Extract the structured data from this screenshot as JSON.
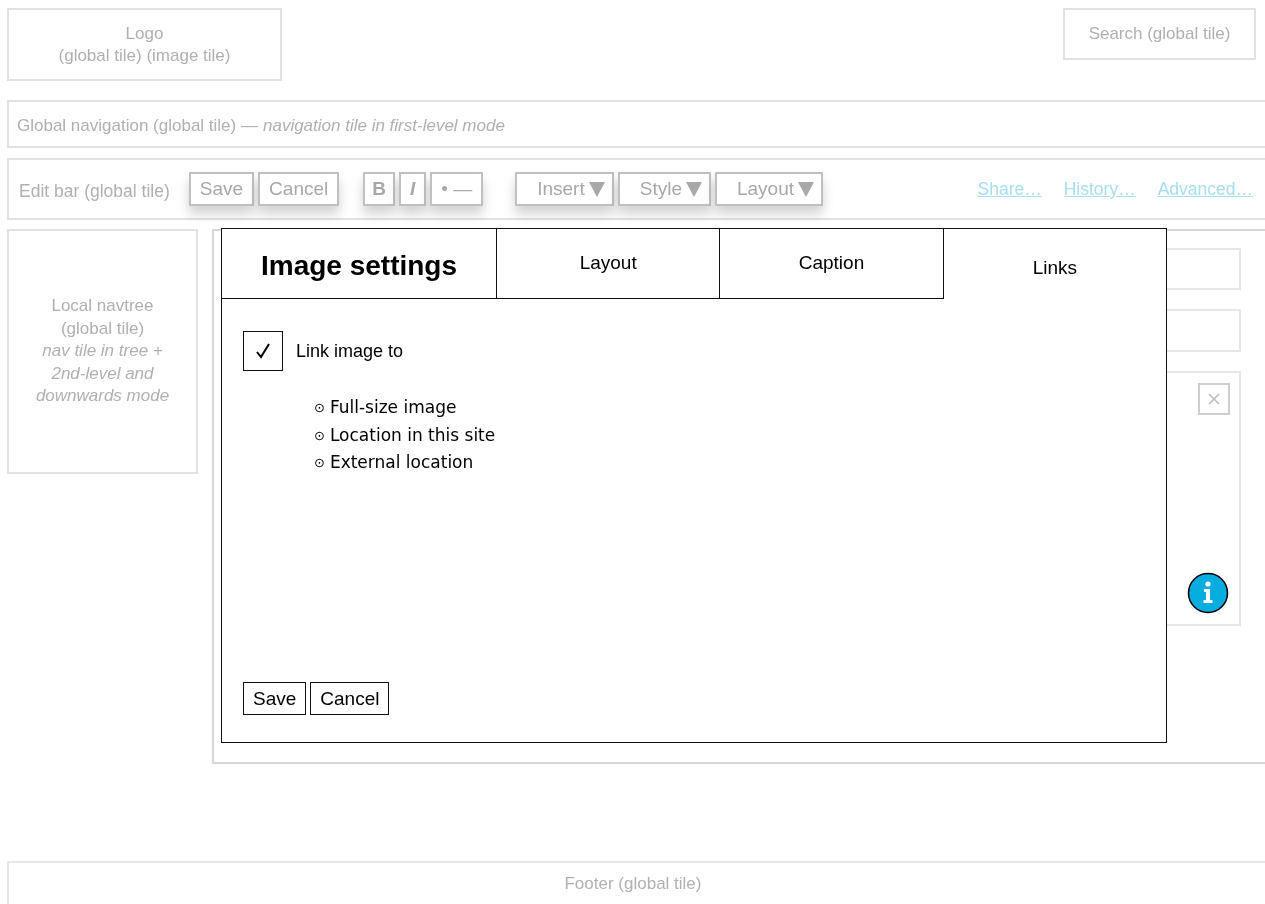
{
  "header": {
    "logo": [
      "Logo",
      "(global tile) (image tile)"
    ],
    "search": "Search (global tile)"
  },
  "global_nav": {
    "label": "Global navigation (global tile) —",
    "note": "navigation tile in first-level mode"
  },
  "edit_bar": {
    "label": "Edit bar (global tile)",
    "buttons": [
      {
        "kind": "text",
        "label": "Save"
      },
      {
        "kind": "text",
        "label": "Cancel"
      },
      {
        "kind": "bold",
        "label": "B"
      },
      {
        "kind": "italic",
        "label": "I"
      },
      {
        "kind": "text",
        "label": "• —"
      },
      {
        "kind": "dropdown",
        "label": "Insert"
      },
      {
        "kind": "dropdown",
        "label": "Style"
      },
      {
        "kind": "dropdown",
        "label": "Layout"
      }
    ],
    "links": [
      "Share…",
      "History…",
      "Advanced…"
    ]
  },
  "navtree": {
    "label": [
      "Local navtree",
      "(global tile)"
    ],
    "note": [
      "nav tile in tree +",
      "2nd-level and",
      "downwards mode"
    ]
  },
  "dialog": {
    "title": "Image settings",
    "tabs": [
      {
        "label": "Layout",
        "selected": false
      },
      {
        "label": "Caption",
        "selected": false
      },
      {
        "label": "Links",
        "selected": true
      }
    ],
    "checkbox": {
      "label": "Link image to",
      "checked": true
    },
    "options": [
      {
        "mark": "⊙",
        "label": "Full-size image"
      },
      {
        "mark": "⊙",
        "label": "Location in this site"
      },
      {
        "mark": "⊙",
        "label": "External location"
      }
    ],
    "buttons": [
      "Save",
      "Cancel"
    ]
  },
  "footer": "Footer (global tile)"
}
